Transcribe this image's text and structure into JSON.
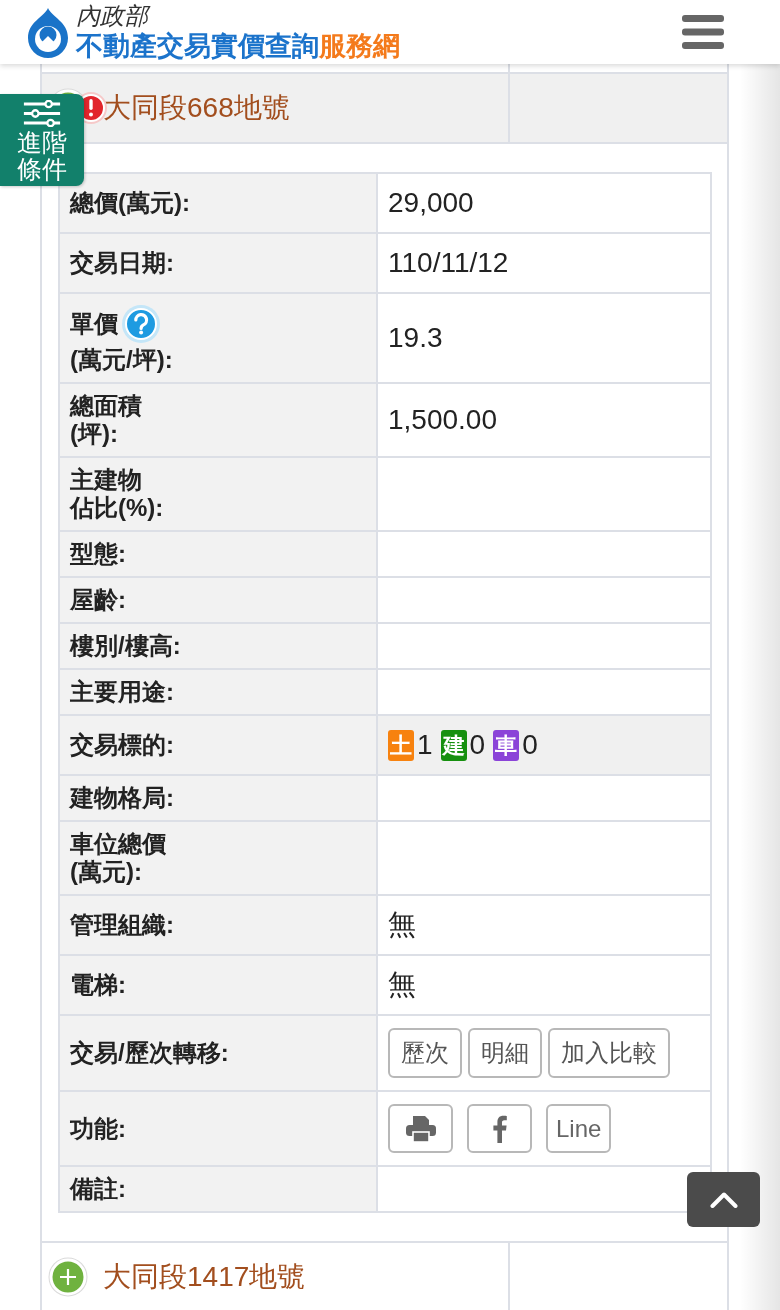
{
  "header": {
    "ministry": "內政部",
    "title": "不動產交易實價查詢",
    "title_accent": "服務網"
  },
  "filter_button": {
    "label": "進階條件"
  },
  "records": [
    {
      "title": "大同段668地號",
      "expanded": true,
      "warning": true,
      "fields": [
        {
          "kind": "text",
          "label": [
            "總價(萬元):"
          ],
          "value": "29,000"
        },
        {
          "kind": "text",
          "label": [
            "交易日期:"
          ],
          "value": "110/11/12"
        },
        {
          "kind": "text",
          "label": [
            "單價",
            "(萬元/坪):"
          ],
          "help": true,
          "value": "19.3"
        },
        {
          "kind": "text",
          "label": [
            "總面積",
            "(坪):"
          ],
          "value": "1,500.00"
        },
        {
          "kind": "text",
          "label": [
            "主建物",
            "佔比(%):"
          ]
        },
        {
          "kind": "text",
          "label": [
            "型態:"
          ]
        },
        {
          "kind": "text",
          "label": [
            "屋齡:"
          ]
        },
        {
          "kind": "text",
          "label": [
            "樓別/樓高:"
          ]
        },
        {
          "kind": "text",
          "label": [
            "主要用途:"
          ]
        },
        {
          "kind": "tags",
          "label": [
            "交易標的:"
          ],
          "highlighted": true,
          "tags": [
            {
              "char": "土",
              "count": "1",
              "color": "#f7820f"
            },
            {
              "char": "建",
              "count": "0",
              "color": "#16900f"
            },
            {
              "char": "車",
              "count": "0",
              "color": "#8b44d8"
            }
          ]
        },
        {
          "kind": "text",
          "label": [
            "建物格局:"
          ]
        },
        {
          "kind": "text",
          "label": [
            "車位總價",
            "(萬元):"
          ]
        },
        {
          "kind": "text",
          "label": [
            "管理組織:"
          ],
          "value": "無"
        },
        {
          "kind": "text",
          "label": [
            "電梯:"
          ],
          "value": "無"
        },
        {
          "kind": "buttons",
          "label": [
            "交易/歷次轉移:"
          ],
          "buttons": [
            {
              "label": "歷次"
            },
            {
              "label": "明細"
            },
            {
              "label": "加入比較"
            }
          ]
        },
        {
          "kind": "tools",
          "label": [
            "功能:"
          ],
          "buttons": [
            {
              "kind": "printer"
            },
            {
              "kind": "f-logo"
            },
            {
              "kind": "text",
              "label": "Line"
            }
          ]
        },
        {
          "kind": "text",
          "label": [
            "備註:"
          ]
        }
      ]
    },
    {
      "title": "大同段1417地號",
      "expanded": false,
      "warning": false
    }
  ]
}
